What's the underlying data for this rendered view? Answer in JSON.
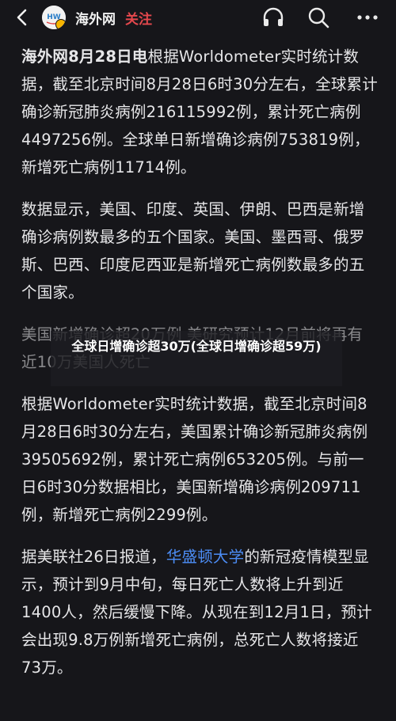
{
  "header": {
    "account_name": "海外网",
    "follow_label": "关注",
    "avatar_text": "HW"
  },
  "article": {
    "p1_prefix": "海外网8月28日电",
    "p1_rest": "根据Worldometer实时统计数据，截至北京时间8月28日6时30分左右，全球累计确诊新冠肺炎病例216115992例，累计死亡病例4497256例。全球单日新增确诊病例753819例，新增死亡病例11714例。",
    "p2": "数据显示，美国、印度、英国、伊朗、巴西是新增确诊病例数最多的五个国家。美国、墨西哥、俄罗斯、巴西、印度尼西亚是新增死亡病例数最多的五个国家。",
    "p3": "美国新增确诊超20万例 美研究预计12月前将再有近10万美国人死亡",
    "p4": "根据Worldometer实时统计数据，截至北京时间8月28日6时30分左右，美国累计确诊新冠肺炎病例39505692例，累计死亡病例653205例。与前一日6时30分数据相比，美国新增确诊病例209711例，新增死亡病例2299例。",
    "p5_before": "据美联社26日报道，",
    "p5_link": "华盛顿大学",
    "p5_after": "的新冠疫情模型显示，预计到9月中旬，每日死亡人数将上升到近1400人，然后缓慢下降。从现在到12月1日，预计会出现9.8万例新增死亡病例，总死亡人数将接近73万。"
  },
  "caption": {
    "text": "全球日增确诊超30万(全球日增确诊超59万)"
  },
  "colors": {
    "background": "#16161a",
    "follow": "#e5484d",
    "link": "#4c8df6"
  }
}
